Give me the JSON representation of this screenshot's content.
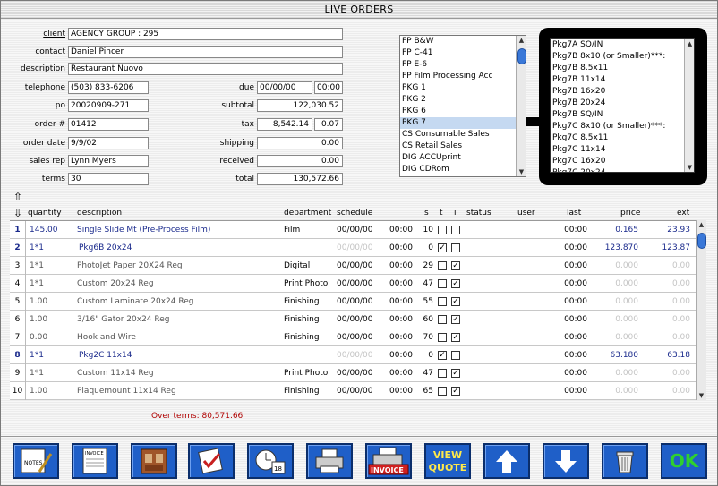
{
  "window": {
    "title": "LIVE ORDERS"
  },
  "form": {
    "client_label": "client",
    "client": "AGENCY GROUP : 295",
    "contact_label": "contact",
    "contact": "Daniel Pincer",
    "description_label": "description",
    "description": "Restaurant Nuovo",
    "telephone_label": "telephone",
    "telephone": "(503) 833-6206",
    "po_label": "po",
    "po": "20020909-271",
    "order_label": "order #",
    "order": "01412",
    "order_date_label": "order date",
    "order_date": "9/9/02",
    "sales_rep_label": "sales rep",
    "sales_rep": "Lynn Myers",
    "terms_label": "terms",
    "terms": "30",
    "due_label": "due",
    "due_date": "00/00/00",
    "due_time": "00:00",
    "subtotal_label": "subtotal",
    "subtotal": "122,030.52",
    "tax_label": "tax",
    "tax": "8,542.14",
    "tax_rate": "0.07",
    "shipping_label": "shipping",
    "shipping": "0.00",
    "received_label": "received",
    "received": "0.00",
    "total_label": "total",
    "total": "130,572.66"
  },
  "category_list": [
    "FP B&W",
    "FP C-41",
    "FP E-6",
    "FP Film Processing Acc",
    "PKG 1",
    "PKG 2",
    "PKG 6",
    "PKG 7",
    "CS Consumable Sales",
    "CS Retail Sales",
    "DIG ACCUprint",
    "DIG CDRom"
  ],
  "category_selected": "PKG 7",
  "package_list": [
    "Pkg7A SQ/IN",
    "Pkg7B  8x10 (or Smaller)***:",
    "Pkg7B  8.5x11",
    "Pkg7B 11x14",
    "Pkg7B 16x20",
    "Pkg7B 20x24",
    "Pkg7B SQ/IN",
    "Pkg7C  8x10 (or Smaller)***:",
    "Pkg7C  8.5x11",
    "Pkg7C 11x14",
    "Pkg7C 16x20",
    "Pkg7C 20x24",
    "Pkg7C 30x40"
  ],
  "columns": {
    "quantity": "quantity",
    "description": "description",
    "department": "department",
    "schedule": "schedule",
    "s": "s",
    "t": "t",
    "i": "i",
    "status": "status",
    "user": "user",
    "last": "last",
    "price": "price",
    "ext": "ext"
  },
  "rows": [
    {
      "n": "1",
      "qty": "145.00",
      "desc": "Single Slide Mt (Pre-Process Film)",
      "dept": "Film",
      "date": "00/00/00",
      "time": "00:00",
      "s": "10",
      "t": false,
      "i": false,
      "last": "00:00",
      "price": "0.165",
      "ext": "23.93",
      "style": "blue"
    },
    {
      "n": "2",
      "qty": "1*1",
      "desc": "Pkg6B 20x24",
      "dept": "",
      "date": "00/00/00",
      "time": "00:00",
      "s": "0",
      "t": true,
      "i": false,
      "last": "00:00",
      "price": "123.870",
      "ext": "123.87",
      "style": "blue",
      "indent": true,
      "ph_sched": true
    },
    {
      "n": "3",
      "qty": "1*1",
      "desc": "PhotoJet Paper 20X24 Reg",
      "dept": "Digital",
      "date": "00/00/00",
      "time": "00:00",
      "s": "29",
      "t": false,
      "i": true,
      "last": "00:00",
      "price": "0.000",
      "ext": "0.00",
      "style": "gray"
    },
    {
      "n": "4",
      "qty": "1*1",
      "desc": "Custom 20x24 Reg",
      "dept": "Print Photo",
      "date": "00/00/00",
      "time": "00:00",
      "s": "47",
      "t": false,
      "i": true,
      "last": "00:00",
      "price": "0.000",
      "ext": "0.00",
      "style": "gray"
    },
    {
      "n": "5",
      "qty": "1.00",
      "desc": "Custom Laminate 20x24 Reg",
      "dept": "Finishing",
      "date": "00/00/00",
      "time": "00:00",
      "s": "55",
      "t": false,
      "i": true,
      "last": "00:00",
      "price": "0.000",
      "ext": "0.00",
      "style": "gray"
    },
    {
      "n": "6",
      "qty": "1.00",
      "desc": "3/16\" Gator 20x24 Reg",
      "dept": "Finishing",
      "date": "00/00/00",
      "time": "00:00",
      "s": "60",
      "t": false,
      "i": true,
      "last": "00:00",
      "price": "0.000",
      "ext": "0.00",
      "style": "gray"
    },
    {
      "n": "7",
      "qty": "0.00",
      "desc": "Hook and Wire",
      "dept": "Finishing",
      "date": "00/00/00",
      "time": "00:00",
      "s": "70",
      "t": false,
      "i": true,
      "last": "00:00",
      "price": "0.000",
      "ext": "0.00",
      "style": "gray"
    },
    {
      "n": "8",
      "qty": "1*1",
      "desc": "Pkg2C 11x14",
      "dept": "",
      "date": "00/00/00",
      "time": "00:00",
      "s": "0",
      "t": true,
      "i": false,
      "last": "00:00",
      "price": "63.180",
      "ext": "63.18",
      "style": "blue",
      "indent": true,
      "ph_sched": true
    },
    {
      "n": "9",
      "qty": "1*1",
      "desc": "Custom 11x14 Reg",
      "dept": "Print Photo",
      "date": "00/00/00",
      "time": "00:00",
      "s": "47",
      "t": false,
      "i": true,
      "last": "00:00",
      "price": "0.000",
      "ext": "0.00",
      "style": "gray"
    },
    {
      "n": "10",
      "qty": "1.00",
      "desc": "Plaquemount 11x14 Reg",
      "dept": "Finishing",
      "date": "00/00/00",
      "time": "00:00",
      "s": "65",
      "t": false,
      "i": true,
      "last": "00:00",
      "price": "0.000",
      "ext": "0.00",
      "style": "gray"
    }
  ],
  "over_terms": "Over terms: 80,571.66",
  "buttons": {
    "notes": "NOTES",
    "invoice_doc": "INVOICE",
    "invoice": "INVOICE",
    "view_quote_1": "VIEW",
    "view_quote_2": "QUOTE",
    "ok": "OK",
    "cal_day": "18"
  },
  "colors": {
    "button_blue": "#1f5fc8",
    "button_text": "#ffe94a",
    "ok_green": "#2fd02f",
    "over_terms_red": "#b00000",
    "selected_row": "#c5d9f1"
  }
}
